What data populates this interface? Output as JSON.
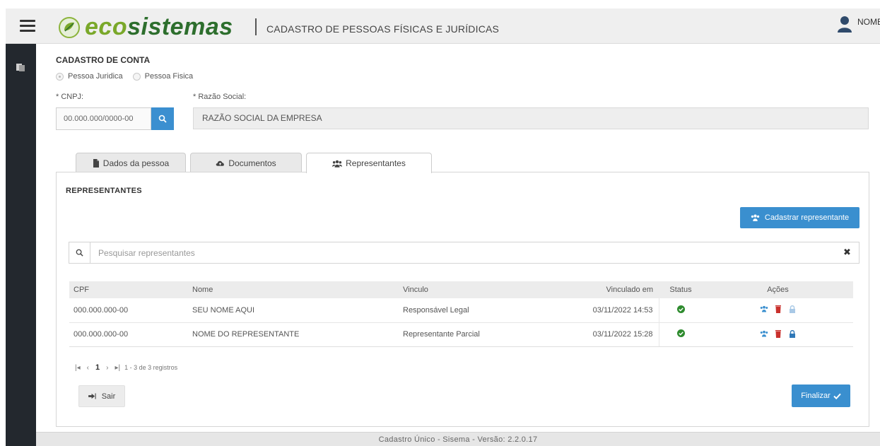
{
  "header": {
    "brand_part1": "eco",
    "brand_part2": "sistemas",
    "subtitle": "CADASTRO DE PESSOAS FÍSICAS E JURÍDICAS",
    "user_name": "NOME"
  },
  "form": {
    "section_title": "CADASTRO DE CONTA",
    "radio_pj": "Pessoa Juridica",
    "radio_pf": "Pessoa Fisica",
    "cnpj_label": "* CNPJ:",
    "cnpj_value": "00.000.000/0000-00",
    "razao_label": "* Razão Social:",
    "razao_value": "RAZÃO SOCIAL DA EMPRESA"
  },
  "tabs": [
    {
      "label": "Dados da pessoa",
      "icon": "file-icon"
    },
    {
      "label": "Documentos",
      "icon": "cloud-upload-icon"
    },
    {
      "label": "Representantes",
      "icon": "users-icon",
      "active": true
    }
  ],
  "representantes": {
    "title": "REPRESENTANTES",
    "add_button": "Cadastrar representante",
    "search_placeholder": "Pesquisar representantes",
    "columns": [
      "CPF",
      "Nome",
      "Vinculo",
      "Vinculado em",
      "Status",
      "Ações"
    ],
    "rows": [
      {
        "cpf": "000.000.000-00",
        "nome": "SEU NOME AQUI",
        "vinculo": "Responsável Legal",
        "data": "03/11/2022 14:53",
        "status": "ativo"
      },
      {
        "cpf": "000.000.000-00",
        "nome": "NOME DO REPRESENTANTE",
        "vinculo": "Representante Parcial",
        "data": "03/11/2022 15:28",
        "status": "ativo"
      }
    ],
    "pager_current": "1",
    "pager_info": "1 - 3 de 3 registros"
  },
  "actions": {
    "exit": "Sair",
    "finish": "Finalizar"
  },
  "footer": {
    "text": "Cadastro Único - Sisema - Versão: 2.2.0.17"
  },
  "colors": {
    "accent_blue": "#3a8fcf",
    "brand_light_green": "#7aa82a",
    "brand_dark_green": "#2d6e2d",
    "status_green": "#2e8b2e",
    "delete_red": "#c9302c",
    "sidebar_dark": "#23282e"
  }
}
